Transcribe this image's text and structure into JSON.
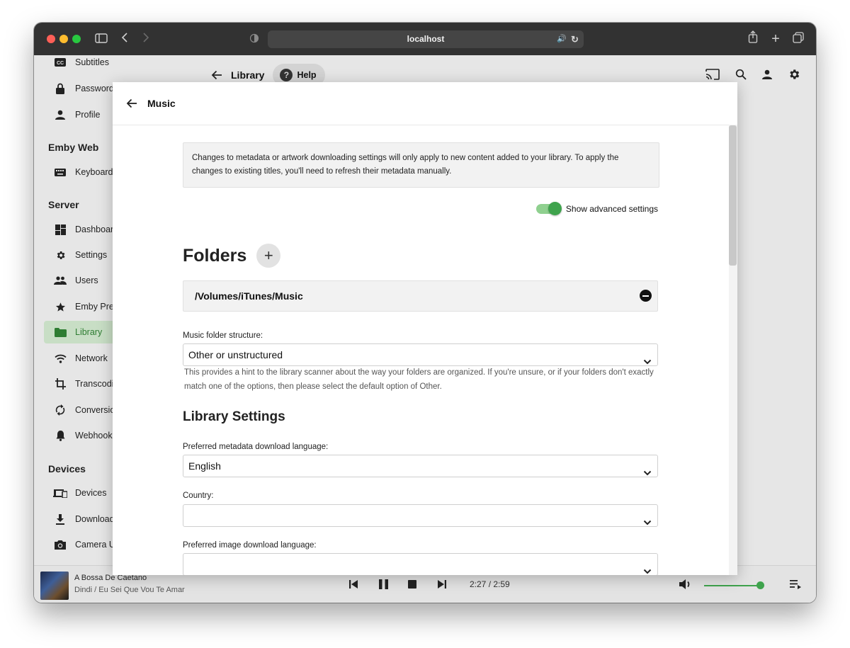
{
  "browser": {
    "url": "localhost"
  },
  "sidebar": {
    "top_items": [
      {
        "label": "Subtitles",
        "icon": "cc-icon"
      },
      {
        "label": "Password",
        "icon": "lock-icon"
      },
      {
        "label": "Profile",
        "icon": "person-icon"
      }
    ],
    "sections": [
      {
        "title": "Emby Web",
        "items": [
          {
            "label": "Keyboard",
            "icon": "keyboard-icon"
          }
        ]
      },
      {
        "title": "Server",
        "items": [
          {
            "label": "Dashboard",
            "icon": "dashboard-icon"
          },
          {
            "label": "Settings",
            "icon": "gear-icon"
          },
          {
            "label": "Users",
            "icon": "users-icon"
          },
          {
            "label": "Emby Pre",
            "icon": "star-icon"
          },
          {
            "label": "Library",
            "icon": "folder-icon",
            "active": true
          },
          {
            "label": "Network",
            "icon": "wifi-icon"
          },
          {
            "label": "Transcodi",
            "icon": "crop-icon"
          },
          {
            "label": "Conversio",
            "icon": "sync-icon"
          },
          {
            "label": "Webhooks",
            "icon": "bell-icon"
          }
        ]
      },
      {
        "title": "Devices",
        "items": [
          {
            "label": "Devices",
            "icon": "devices-icon"
          },
          {
            "label": "Download",
            "icon": "download-icon"
          },
          {
            "label": "Camera U",
            "icon": "camera-icon"
          }
        ]
      }
    ]
  },
  "topnav": {
    "back_label": "Library",
    "help_label": "Help"
  },
  "dialog": {
    "title": "Music",
    "info_text": "Changes to metadata or artwork downloading settings will only apply to new content added to your library. To apply the changes to existing titles, you'll need to refresh their metadata manually.",
    "advanced_toggle": {
      "label": "Show advanced settings",
      "on": true
    },
    "folders_heading": "Folders",
    "folders": [
      "/Volumes/iTunes/Music"
    ],
    "folder_structure": {
      "label": "Music folder structure:",
      "value": "Other or unstructured",
      "hint": "This provides a hint to the library scanner about the way your folders are organized. If you're unsure, or if your folders don't exactly match one of the options, then please select the default option of Other."
    },
    "library_settings_heading": "Library Settings",
    "metadata_language": {
      "label": "Preferred metadata download language:",
      "value": "English"
    },
    "country": {
      "label": "Country:",
      "value": ""
    },
    "image_language": {
      "label": "Preferred image download language:",
      "value": ""
    }
  },
  "player": {
    "track_title": "A Bossa De Caetano",
    "track_subtitle": "Dindi / Eu Sei Que Vou Te Amar",
    "time": "2:27 / 2:59",
    "volume_fraction": 1.0
  },
  "colors": {
    "accent": "#3fa34d",
    "active_bg": "#c8dec5"
  }
}
